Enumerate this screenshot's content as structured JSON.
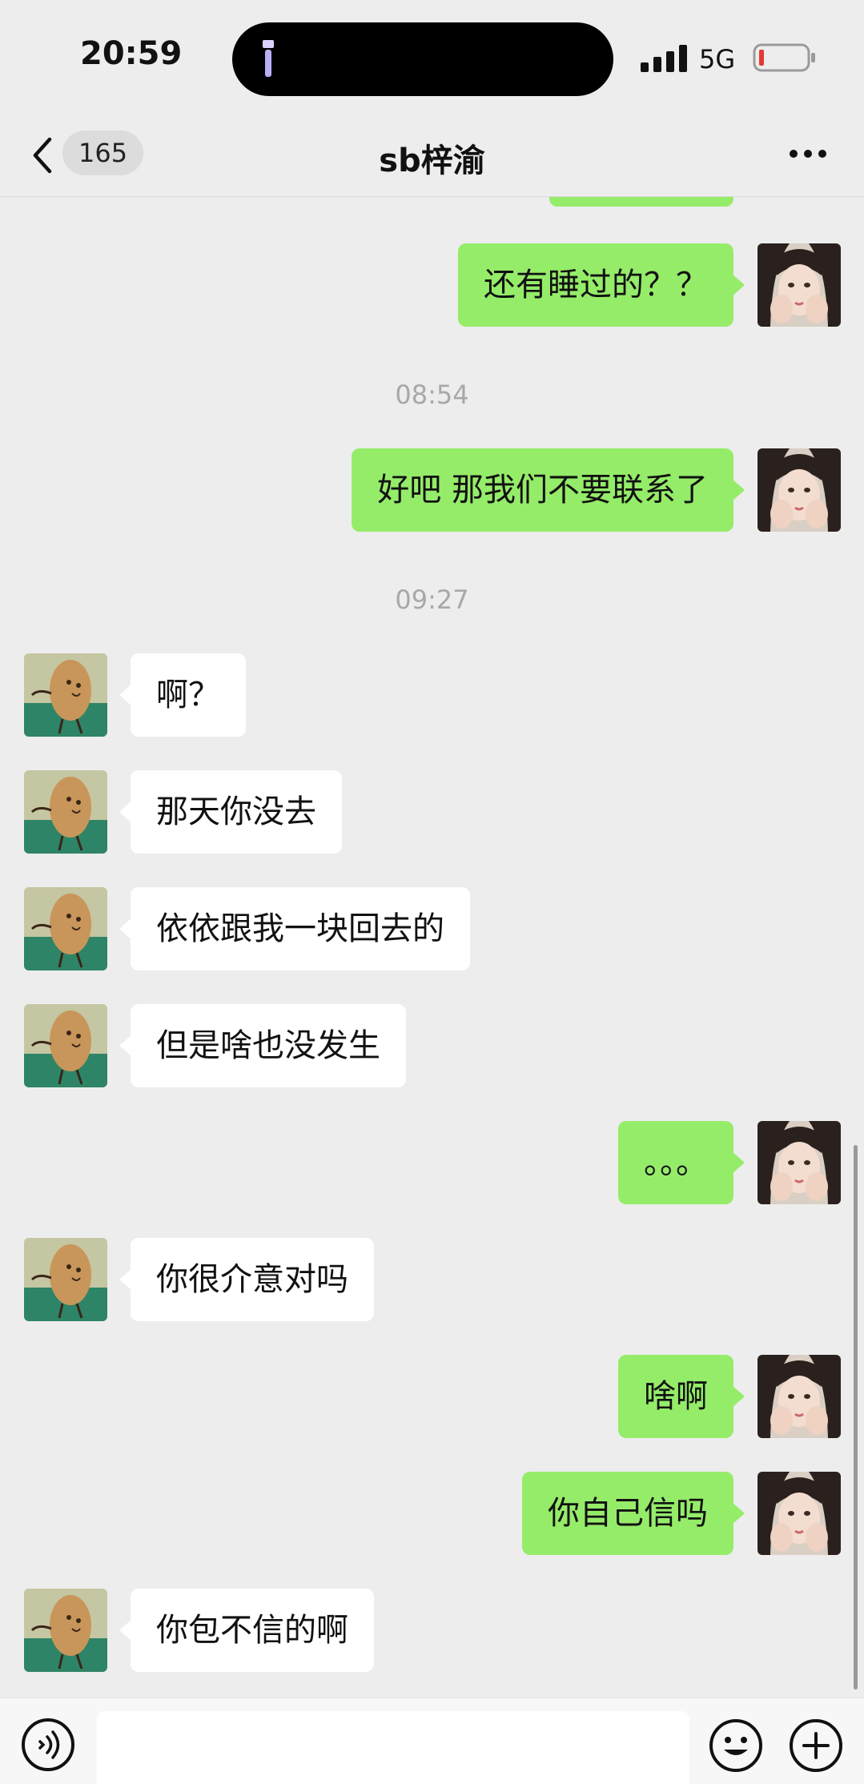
{
  "status": {
    "time": "20:59",
    "network": "5G"
  },
  "nav": {
    "unread_count": "165",
    "title": "sb梓渝"
  },
  "messages": [
    {
      "text": "还有睡过的？？"
    },
    {
      "text": "08:54"
    },
    {
      "text": "好吧  那我们不要联系了"
    },
    {
      "text": "09:27"
    },
    {
      "text": "啊？"
    },
    {
      "text": "那天你没去"
    },
    {
      "text": "依依跟我一块回去的"
    },
    {
      "text": "但是啥也没发生"
    },
    {
      "text": "。。。"
    },
    {
      "text": "你很介意对吗"
    },
    {
      "text": "啥啊"
    },
    {
      "text": "你自己信吗"
    },
    {
      "text": "你包不信的啊"
    }
  ],
  "input": {
    "placeholder": ""
  },
  "colors": {
    "sent_bubble": "#95ec69",
    "received_bubble": "#ffffff",
    "background": "#ededed"
  },
  "icons": [
    "flashlight-icon",
    "signal-icon",
    "battery-icon",
    "back-icon",
    "more-icon",
    "voice-icon",
    "emoji-icon",
    "plus-icon"
  ]
}
